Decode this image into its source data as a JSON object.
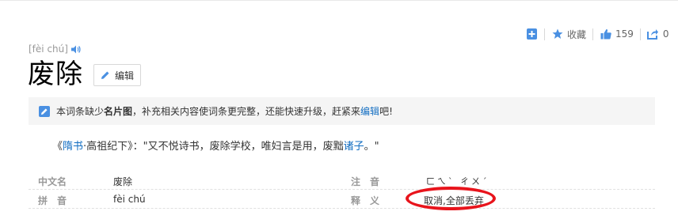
{
  "toolbar": {
    "collect_label": "收藏",
    "like_count": "159",
    "share_count": "0"
  },
  "entry": {
    "pinyin": "[fèi chú]",
    "title": "废除",
    "edit_label": "编辑"
  },
  "notice": {
    "prefix": "本词条缺少",
    "bold_text": "名片图",
    "middle": "，补充相关内容使词条更完整，还能快速升级，赶紧来",
    "link_text": "编辑",
    "suffix": "吧!"
  },
  "quote": {
    "open": "《",
    "book_link": "隋书",
    "book_rest": "·高祖纪下》：\"又不悦诗书，废除学校，唯妇言是用，废黜",
    "link2": "诸子",
    "close": "。\""
  },
  "info": {
    "row1": {
      "k1": "中文名",
      "v1": "废除",
      "k2": "注　音",
      "v2": "ㄈㄟˋ ㄔㄨˊ"
    },
    "row2": {
      "k1": "拼　音",
      "v1": "fèi chú",
      "k2": "释　义",
      "v2": "取消,全部丢弃"
    }
  },
  "colors": {
    "accent_blue": "#4a90e2",
    "link": "#136ec2",
    "highlight_red": "#e8141c"
  }
}
